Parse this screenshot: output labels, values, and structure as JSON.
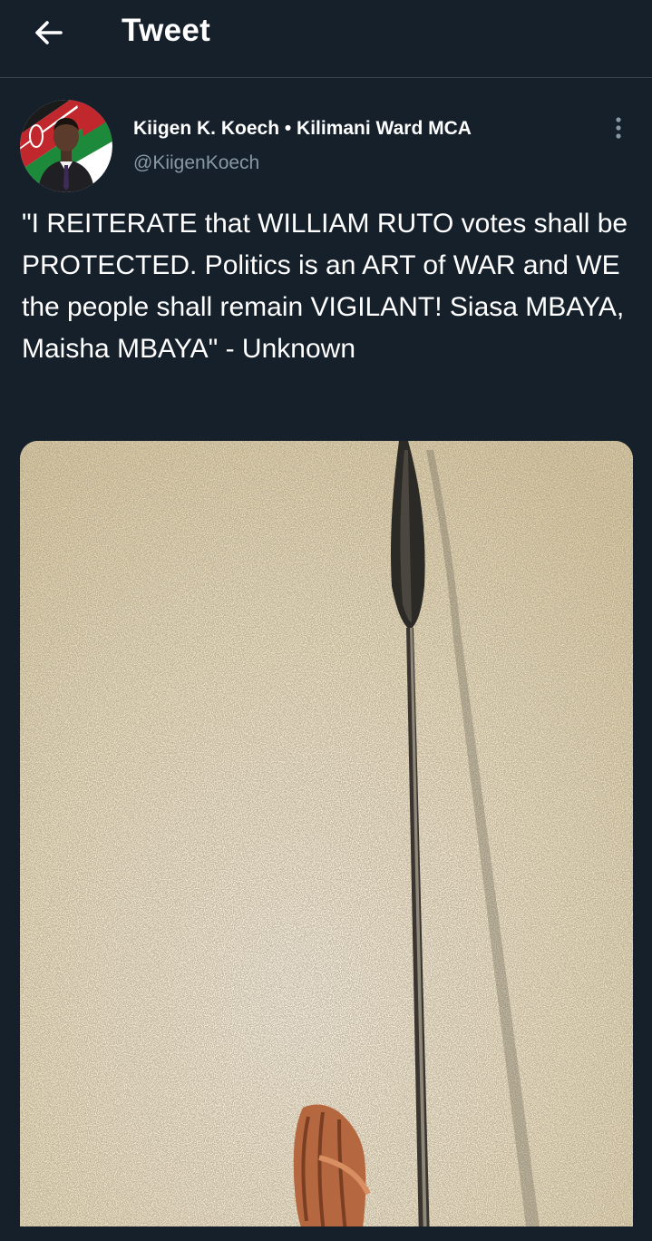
{
  "header": {
    "title": "Tweet",
    "back_icon": "arrow-left-icon"
  },
  "tweet": {
    "author_name": "Kiigen K. Koech • Kilimani Ward MCA",
    "author_handle": "@KiigenKoech",
    "text": "\"I REITERATE that WILLIAM RUTO votes shall be PROTECTED. Politics is an ART of WAR and WE the people shall remain VIGILANT! Siasa MBAYA, Maisha MBAYA\" - Unknown",
    "more_icon": "more-vertical-icon"
  },
  "colors": {
    "background": "#15202b",
    "divider": "#38444d",
    "secondary_text": "#8899a6",
    "primary_text": "#ffffff"
  }
}
